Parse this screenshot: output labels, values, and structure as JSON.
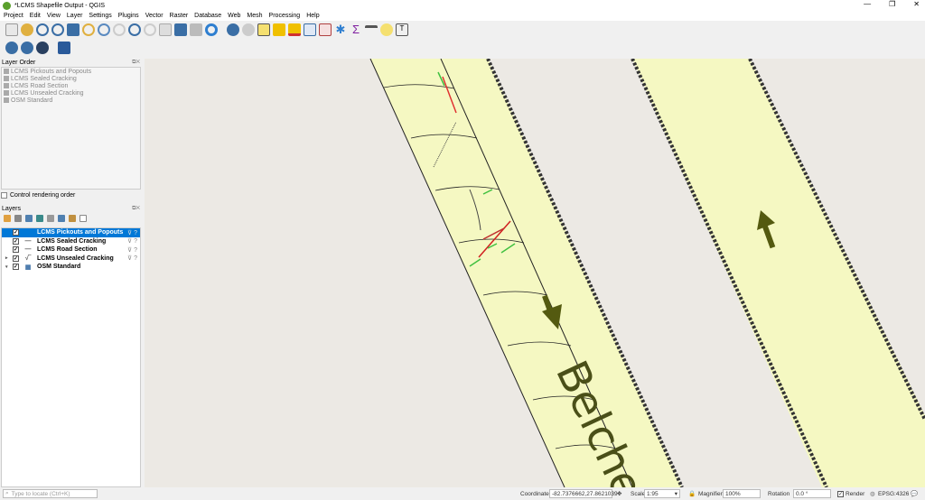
{
  "window": {
    "title": "*LCMS Shapefile Output - QGIS",
    "controls": [
      "—",
      "❐",
      "✕"
    ]
  },
  "menu": [
    "Project",
    "Edit",
    "View",
    "Layer",
    "Settings",
    "Plugins",
    "Vector",
    "Raster",
    "Database",
    "Web",
    "Mesh",
    "Processing",
    "Help"
  ],
  "layer_order": {
    "title": "Layer Order",
    "items": [
      "LCMS Pickouts and Popouts",
      "LCMS Sealed Cracking",
      "LCMS Road Section",
      "LCMS Unsealed Cracking",
      "OSM Standard"
    ],
    "control_label": "Control rendering order"
  },
  "layers": {
    "title": "Layers",
    "items": [
      {
        "name": "LCMS Pickouts and Popouts",
        "symbol": "",
        "checked": "✓",
        "selected": true,
        "expand": ""
      },
      {
        "name": "LCMS Sealed Cracking",
        "symbol": "—",
        "checked": "✓",
        "expand": ""
      },
      {
        "name": "LCMS Road Section",
        "symbol": "—",
        "checked": "✓",
        "expand": ""
      },
      {
        "name": "LCMS Unsealed Cracking",
        "symbol": "√‾",
        "checked": "✓",
        "expand": "▸"
      },
      {
        "name": "OSM Standard",
        "symbol": "▦",
        "checked": "✓",
        "expand": "▾"
      }
    ]
  },
  "map": {
    "label": "Belche"
  },
  "status": {
    "locate_placeholder": "Type to locate (Ctrl+K)",
    "coordinate_label": "Coordinate",
    "coordinate": "-82.7376662,27.8621039",
    "scale_label": "Scale",
    "scale": "1:95",
    "magnifier_label": "Magnifier",
    "magnifier": "100%",
    "rotation_label": "Rotation",
    "rotation": "0.0 °",
    "render_label": "Render",
    "crs": "EPSG:4326"
  }
}
